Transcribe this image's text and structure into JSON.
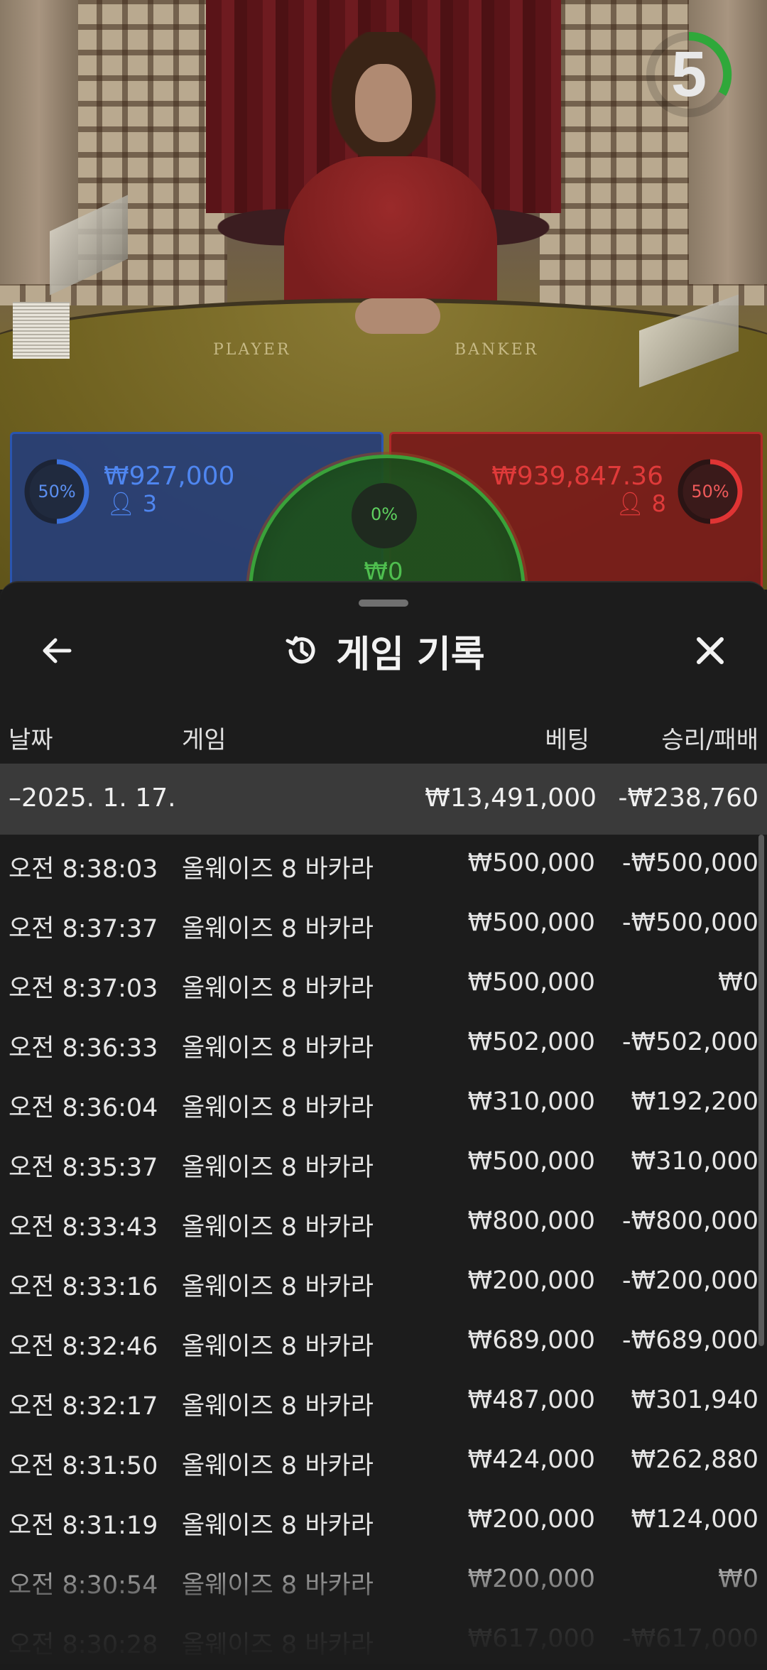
{
  "video": {
    "felt_player": "PLAYER",
    "felt_banker": "BANKER",
    "countdown": "5"
  },
  "bets": {
    "player": {
      "percent_label": "50%",
      "percent_value": 50,
      "amount": "₩927,000",
      "players": "3",
      "color": "#2a55b0"
    },
    "banker": {
      "percent_label": "50%",
      "percent_value": 50,
      "amount": "₩939,847.36",
      "players": "8",
      "color": "#c42b2b"
    },
    "tie": {
      "percent_label": "0%",
      "amount": "₩0",
      "color": "#3aa23a"
    }
  },
  "history": {
    "title": "게임 기록",
    "columns": {
      "date": "날짜",
      "game": "게임",
      "bet": "베팅",
      "result": "승리/패배"
    },
    "date_group": {
      "label": "–2025. 1. 17.",
      "bet_total": "₩13,491,000",
      "result_total": "-₩238,760"
    },
    "rows": [
      {
        "time": "오전 8:38:03",
        "game": "올웨이즈 8 바카라",
        "bet": "₩500,000",
        "result": "-₩500,000"
      },
      {
        "time": "오전 8:37:37",
        "game": "올웨이즈 8 바카라",
        "bet": "₩500,000",
        "result": "-₩500,000"
      },
      {
        "time": "오전 8:37:03",
        "game": "올웨이즈 8 바카라",
        "bet": "₩500,000",
        "result": "₩0"
      },
      {
        "time": "오전 8:36:33",
        "game": "올웨이즈 8 바카라",
        "bet": "₩502,000",
        "result": "-₩502,000"
      },
      {
        "time": "오전 8:36:04",
        "game": "올웨이즈 8 바카라",
        "bet": "₩310,000",
        "result": "₩192,200"
      },
      {
        "time": "오전 8:35:37",
        "game": "올웨이즈 8 바카라",
        "bet": "₩500,000",
        "result": "₩310,000"
      },
      {
        "time": "오전 8:33:43",
        "game": "올웨이즈 8 바카라",
        "bet": "₩800,000",
        "result": "-₩800,000"
      },
      {
        "time": "오전 8:33:16",
        "game": "올웨이즈 8 바카라",
        "bet": "₩200,000",
        "result": "-₩200,000"
      },
      {
        "time": "오전 8:32:46",
        "game": "올웨이즈 8 바카라",
        "bet": "₩689,000",
        "result": "-₩689,000"
      },
      {
        "time": "오전 8:32:17",
        "game": "올웨이즈 8 바카라",
        "bet": "₩487,000",
        "result": "₩301,940"
      },
      {
        "time": "오전 8:31:50",
        "game": "올웨이즈 8 바카라",
        "bet": "₩424,000",
        "result": "₩262,880"
      },
      {
        "time": "오전 8:31:19",
        "game": "올웨이즈 8 바카라",
        "bet": "₩200,000",
        "result": "₩124,000"
      },
      {
        "time": "오전 8:30:54",
        "game": "올웨이즈 8 바카라",
        "bet": "₩200,000",
        "result": "₩0"
      },
      {
        "time": "오전 8:30:28",
        "game": "올웨이즈 8 바카라",
        "bet": "₩617,000",
        "result": "-₩617,000"
      }
    ]
  },
  "icons": {
    "back": "arrow-left-icon",
    "history": "history-icon",
    "close": "close-icon",
    "person": "person-icon"
  }
}
